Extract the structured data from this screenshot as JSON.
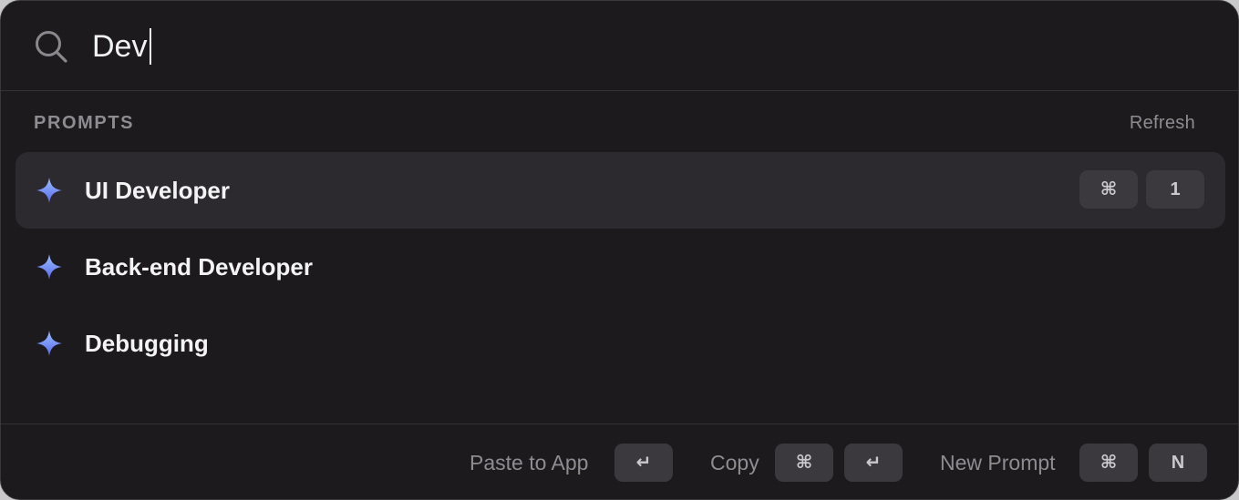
{
  "search": {
    "value": "Dev",
    "icon": "search-icon"
  },
  "section": {
    "title": "PROMPTS",
    "refresh_label": "Refresh"
  },
  "results": [
    {
      "label": "UI Developer",
      "icon": "sparkle-icon",
      "selected": true,
      "shortcut": [
        "⌘",
        "1"
      ]
    },
    {
      "label": "Back-end Developer",
      "icon": "sparkle-icon",
      "selected": false
    },
    {
      "label": "Debugging",
      "icon": "sparkle-icon",
      "selected": false
    }
  ],
  "footer": {
    "paste_label": "Paste to App",
    "paste_key": "↵",
    "copy_label": "Copy",
    "copy_keys": [
      "⌘",
      "↵"
    ],
    "new_prompt_label": "New Prompt",
    "new_prompt_keys": [
      "⌘",
      "N"
    ]
  },
  "colors": {
    "background": "#1c1a1d",
    "selected_row": "#2c2a2e",
    "key_cap": "#3b393d",
    "sparkle_top": "#8fb4ff",
    "sparkle_bottom": "#5a6cf0"
  }
}
